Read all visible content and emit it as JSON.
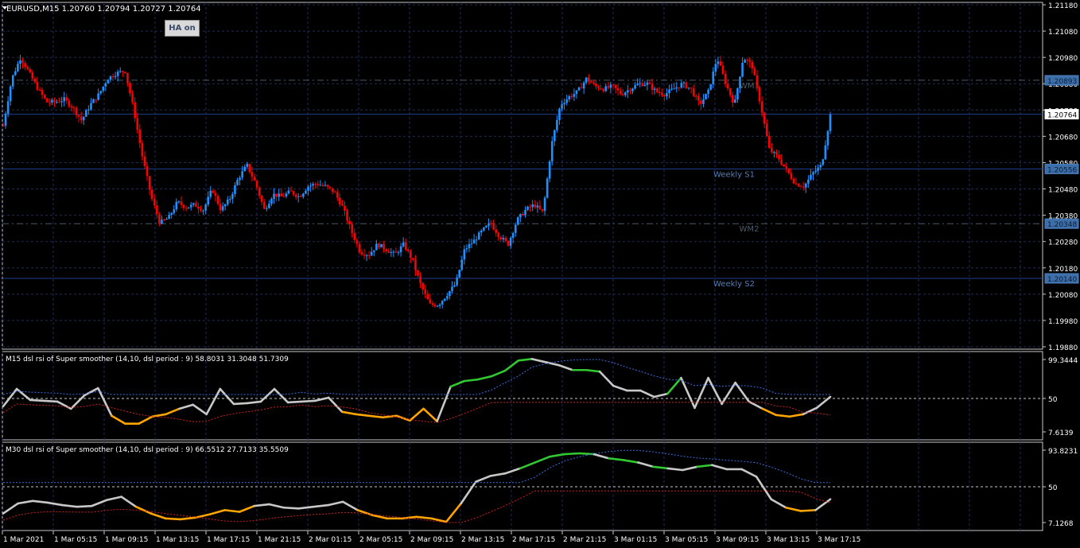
{
  "header": {
    "symbol_line": "EURUSD,M15  1.20760 1.20794 1.20727 1.20764",
    "ha_button_label": "HA on"
  },
  "colors": {
    "background": "#000000",
    "grid": "#1c2a63",
    "bull_candle": "#1e90ff",
    "bear_candle": "#ff0000",
    "line_white": "#c8c8c8",
    "line_green": "#32c832",
    "line_orange": "#ffa500",
    "level_blue": "#1f3f8f",
    "level_dark": "#37474f"
  },
  "main_price_axis": {
    "ticks": [
      "1.21180",
      "1.21080",
      "1.20980",
      "1.20880",
      "1.20780",
      "1.20680",
      "1.20580",
      "1.20480",
      "1.20380",
      "1.20280",
      "1.20180",
      "1.20080",
      "1.19980",
      "1.19880"
    ]
  },
  "levels": [
    {
      "label": "",
      "price_tag": "1.20893",
      "style": "dash-dot",
      "y": 1.20893
    },
    {
      "label": "",
      "price_tag": "1.20764",
      "style": "solid",
      "y": 1.20764,
      "current": true
    },
    {
      "label": "Weekly S1",
      "price_tag": "1.20556",
      "style": "solid",
      "y": 1.20556
    },
    {
      "label": "WM2",
      "price_tag": "1.20348",
      "style": "dash-dot",
      "y": 1.20348
    },
    {
      "label": "Weekly S2",
      "price_tag": "1.20140",
      "style": "solid",
      "y": 1.2014
    }
  ],
  "wm1_label": "WM1",
  "indicator1": {
    "title": "M15 dsl rsi of Super smoother (14,10, dsl period : 9) 58.8031 31.3048 51.7309",
    "ticks": [
      "99.3444",
      "50",
      "7.6139"
    ]
  },
  "indicator2": {
    "title": "M30 dsl rsi of Super smoother (14,10, dsl period : 9) 66.5512 27.7133 35.5509",
    "ticks": [
      "93.8231",
      "50",
      "7.1268"
    ]
  },
  "time_axis": {
    "labels": [
      "1 Mar 2021",
      "1 Mar 05:15",
      "1 Mar 09:15",
      "1 Mar 13:15",
      "1 Mar 17:15",
      "1 Mar 21:15",
      "2 Mar 01:15",
      "2 Mar 05:15",
      "2 Mar 09:15",
      "2 Mar 13:15",
      "2 Mar 17:15",
      "2 Mar 21:15",
      "3 Mar 01:15",
      "3 Mar 05:15",
      "3 Mar 09:15",
      "3 Mar 13:15",
      "3 Mar 17:15"
    ]
  },
  "chart_data": {
    "type": "candlestick",
    "symbol": "EURUSD",
    "timeframe": "M15",
    "close_path": [
      1.2072,
      1.209,
      1.2098,
      1.2092,
      1.2086,
      1.2081,
      1.2081,
      1.2082,
      1.2079,
      1.2074,
      1.208,
      1.2084,
      1.209,
      1.2092,
      1.2093,
      1.2078,
      1.206,
      1.2045,
      1.2035,
      1.2037,
      1.2043,
      1.2041,
      1.2042,
      1.204,
      1.2048,
      1.204,
      1.2044,
      1.2052,
      1.2057,
      1.205,
      1.204,
      1.2046,
      1.2045,
      1.2047,
      1.2045,
      1.2049,
      1.205,
      1.2049,
      1.2047,
      1.2041,
      1.2032,
      1.2024,
      1.2023,
      1.2027,
      1.2025,
      1.2023,
      1.2027,
      1.2021,
      1.2011,
      1.2004,
      1.2004,
      1.2008,
      1.2012,
      1.2025,
      1.2028,
      1.2032,
      1.2035,
      1.203,
      1.2027,
      1.2036,
      1.204,
      1.2042,
      1.2039,
      1.2065,
      1.208,
      1.2083,
      1.2085,
      1.209,
      1.2087,
      1.2086,
      1.2087,
      1.2084,
      1.2086,
      1.2088,
      1.2088,
      1.2085,
      1.2084,
      1.2086,
      1.2088,
      1.2086,
      1.208,
      1.2085,
      1.2098,
      1.2088,
      1.208,
      1.2098,
      1.2095,
      1.208,
      1.2063,
      1.206,
      1.2055,
      1.205,
      1.2049,
      1.2054,
      1.2057,
      1.2076
    ],
    "indicator1": {
      "series": [
        {
          "name": "",
          "values": [
            40,
            62,
            48,
            47,
            46,
            37,
            54,
            63,
            28,
            18,
            18,
            27,
            30,
            37,
            42,
            30,
            62,
            43,
            44,
            46,
            62,
            45,
            46,
            47,
            51,
            33,
            30,
            28,
            26,
            28,
            22,
            37,
            21,
            65,
            72,
            74,
            78,
            85,
            98,
            100,
            96,
            92,
            86,
            86,
            84,
            66,
            60,
            60,
            52,
            56,
            76,
            38,
            76,
            43,
            70,
            46,
            37,
            29,
            27,
            30,
            38,
            52
          ]
        }
      ],
      "ylim": [
        7.6139,
        99.3444
      ]
    },
    "indicator2": {
      "series": [
        {
          "name": "",
          "values": [
            18,
            30,
            33,
            31,
            28,
            26,
            27,
            34,
            38,
            26,
            18,
            12,
            11,
            13,
            17,
            22,
            20,
            27,
            29,
            25,
            24,
            26,
            28,
            32,
            22,
            16,
            12,
            12,
            14,
            12,
            8,
            30,
            56,
            63,
            66,
            72,
            79,
            86,
            89,
            90,
            89,
            84,
            82,
            79,
            74,
            72,
            70,
            74,
            76,
            71,
            71,
            62,
            35,
            25,
            21,
            22,
            35
          ]
        }
      ],
      "ylim": [
        7.1268,
        93.8231
      ]
    }
  }
}
